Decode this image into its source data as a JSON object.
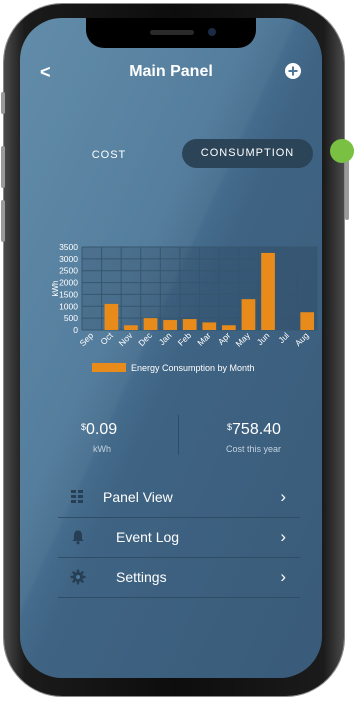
{
  "header": {
    "title": "Main Panel",
    "back_label": "<",
    "add_icon": "plus-circle-icon"
  },
  "tabs": [
    {
      "label": "COST"
    },
    {
      "label": "CONSUMPTION",
      "selected": true
    }
  ],
  "chart_data": {
    "type": "bar",
    "categories": [
      "Sep",
      "Oct",
      "Nov",
      "Dec",
      "Jan",
      "Feb",
      "Mar",
      "Apr",
      "May",
      "Jun",
      "Jul",
      "Aug"
    ],
    "values": [
      0,
      1100,
      200,
      500,
      420,
      460,
      320,
      200,
      1300,
      3250,
      0,
      750
    ],
    "series": [
      {
        "name": "Energy Consumption by Month",
        "values": [
          0,
          1100,
          200,
          500,
          420,
          460,
          320,
          200,
          1300,
          3250,
          0,
          750
        ]
      }
    ],
    "ylabel": "kWh",
    "yticks": [
      "0",
      "500",
      "1000",
      "1500",
      "2000",
      "2500",
      "3000",
      "3500"
    ],
    "ylim": [
      0,
      3500
    ],
    "grid": true,
    "legend_position": "bottom",
    "bar_color": "#e88b1a"
  },
  "stats": {
    "rate": {
      "currency": "$",
      "value": "0.09",
      "label": "kWh"
    },
    "cost": {
      "currency": "$",
      "value": "758.40",
      "label": "Cost this year"
    }
  },
  "menu": [
    {
      "label": "Panel View",
      "icon": "grid-icon"
    },
    {
      "label": "Event Log",
      "icon": "bell-icon"
    },
    {
      "label": "Settings",
      "icon": "gear-icon"
    }
  ],
  "colors": {
    "accent_green": "#7ac143",
    "bar": "#e88b1a",
    "background": "#4d7899"
  }
}
